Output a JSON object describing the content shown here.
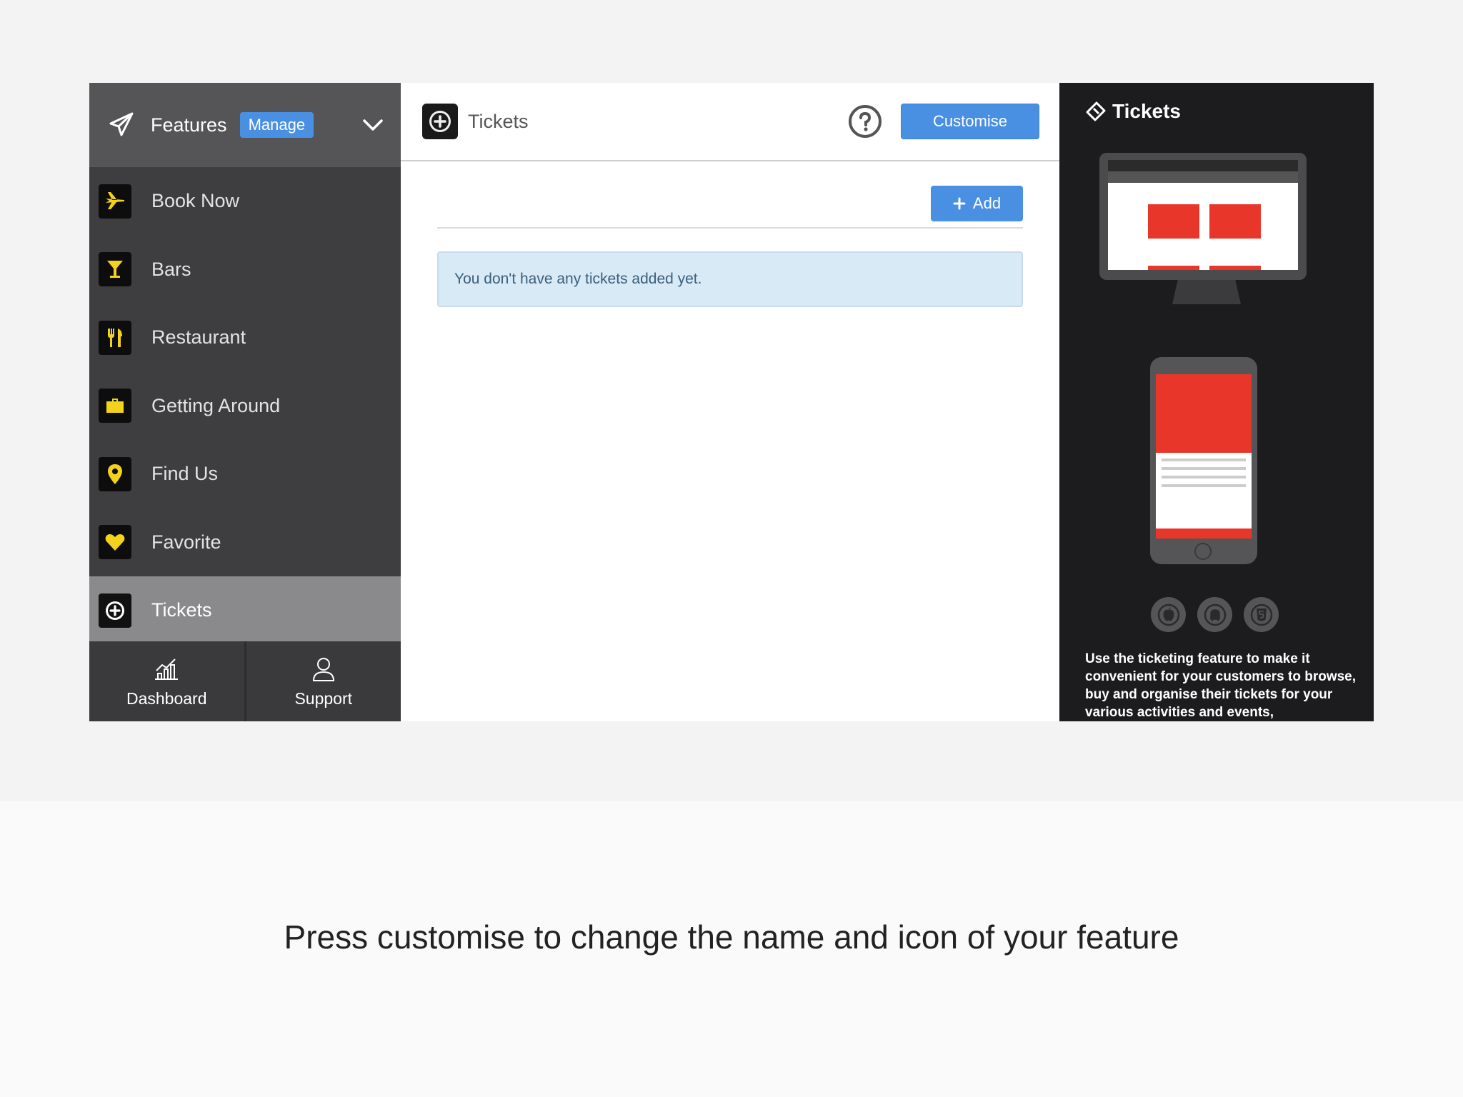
{
  "sidebar": {
    "header": {
      "title": "Features",
      "manage_label": "Manage"
    },
    "items": [
      {
        "label": "Book Now",
        "icon": "plane-icon"
      },
      {
        "label": "Bars",
        "icon": "cocktail-icon"
      },
      {
        "label": "Restaurant",
        "icon": "cutlery-icon"
      },
      {
        "label": "Getting Around",
        "icon": "briefcase-icon"
      },
      {
        "label": "Find Us",
        "icon": "map-pin-icon"
      },
      {
        "label": "Favorite",
        "icon": "heart-icon"
      },
      {
        "label": "Tickets",
        "icon": "plus-circle-icon",
        "active": true
      }
    ],
    "footer": {
      "dashboard_label": "Dashboard",
      "support_label": "Support"
    }
  },
  "main": {
    "title": "Tickets",
    "customise_label": "Customise",
    "add_label": "Add",
    "empty_message": "You don't have any tickets added yet."
  },
  "preview": {
    "title": "Tickets",
    "description": "Use the ticketing feature to make it convenient for your customers to browse, buy and organise their tickets for your various activities and events,"
  },
  "caption": "Press customise to change the name and icon of your feature",
  "colors": {
    "accent": "#4a90e2",
    "sidebar_bg": "#3e3e40",
    "icon_yellow": "#f2d21b",
    "preview_bg": "#1c1c1e",
    "ticket_red": "#e8372a"
  }
}
